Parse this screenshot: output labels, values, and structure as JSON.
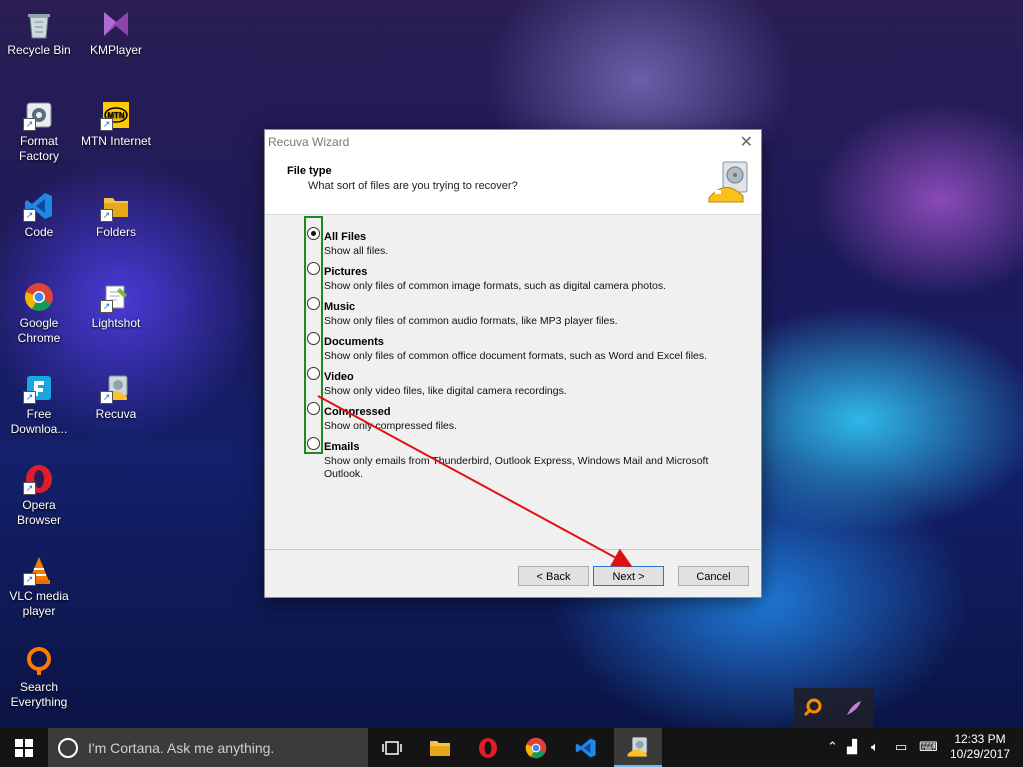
{
  "desktop": {
    "icons": [
      {
        "label": "Recycle Bin",
        "icon": "recycle-bin-icon"
      },
      {
        "label": "KMPlayer",
        "icon": "kmplayer-icon"
      },
      {
        "label": "Format Factory",
        "icon": "format-factory-icon"
      },
      {
        "label": "MTN Internet",
        "icon": "mtn-icon"
      },
      {
        "label": "Code",
        "icon": "vscode-icon"
      },
      {
        "label": "Folders",
        "icon": "folder-icon"
      },
      {
        "label": "Google Chrome",
        "icon": "chrome-icon"
      },
      {
        "label": "Lightshot",
        "icon": "lightshot-icon"
      },
      {
        "label": "Free Downloa...",
        "icon": "free-download-icon"
      },
      {
        "label": "Recuva",
        "icon": "recuva-icon"
      },
      {
        "label": "Opera Browser",
        "icon": "opera-icon"
      },
      {
        "label": "VLC media player",
        "icon": "vlc-icon"
      },
      {
        "label": "Search Everything",
        "icon": "search-everything-icon"
      }
    ]
  },
  "dialog": {
    "title": "Recuva Wizard",
    "close": "✕",
    "header_title": "File type",
    "header_subtitle": "What sort of files are you trying to recover?",
    "options": [
      {
        "label": "All Files",
        "desc": "Show all files.",
        "checked": true
      },
      {
        "label": "Pictures",
        "desc": "Show only files of common image formats, such as digital camera photos.",
        "checked": false
      },
      {
        "label": "Music",
        "desc": "Show only files of common audio formats, like MP3 player files.",
        "checked": false
      },
      {
        "label": "Documents",
        "desc": "Show only files of common office document formats, such as Word and Excel files.",
        "checked": false
      },
      {
        "label": "Video",
        "desc": "Show only video files, like digital camera recordings.",
        "checked": false
      },
      {
        "label": "Compressed",
        "desc": "Show only compressed files.",
        "checked": false
      },
      {
        "label": "Emails",
        "desc": "Show only emails from Thunderbird, Outlook Express, Windows Mail and Microsoft Outlook.",
        "checked": false
      }
    ],
    "buttons": {
      "back": "< Back",
      "next": "Next >",
      "cancel": "Cancel"
    }
  },
  "taskbar": {
    "search_placeholder": "I'm Cortana. Ask me anything.",
    "time": "12:33 PM",
    "date": "10/29/2017"
  },
  "colors": {
    "highlight": "#1f8a1f",
    "arrow": "#e01010",
    "accent": "#2b78d4"
  }
}
